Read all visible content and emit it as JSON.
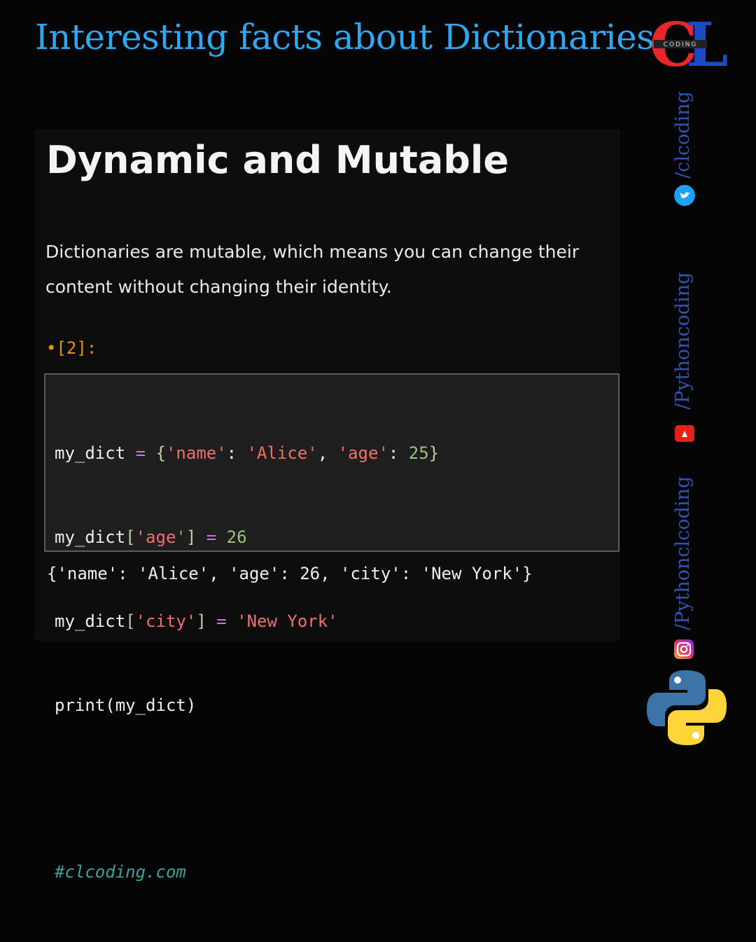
{
  "banner": {
    "title": "Interesting facts about Dictionaries"
  },
  "logo": {
    "letters": "CL",
    "tagline": "CODING"
  },
  "panel": {
    "heading": "Dynamic and Mutable",
    "description": "Dictionaries are mutable, which means you can change their content without changing their identity.",
    "prompt": "•[2]:",
    "code": {
      "line1": {
        "var": "my_dict",
        "op": " = ",
        "open": "{",
        "k1": "'name'",
        "sep1": ": ",
        "v1": "'Alice'",
        "comma": ", ",
        "k2": "'age'",
        "sep2": ": ",
        "v2": "25",
        "close": "}"
      },
      "line2": {
        "var": "my_dict",
        "lb": "[",
        "key": "'age'",
        "rb": "]",
        "op": " = ",
        "val": "26"
      },
      "line3": {
        "var": "my_dict",
        "lb": "[",
        "key": "'city'",
        "rb": "]",
        "op": " = ",
        "val": "'New York'"
      },
      "line4": "print(my_dict)",
      "comment": "#clcoding.com"
    },
    "output": "{'name': 'Alice', 'age': 26, 'city': 'New York'}"
  },
  "social": {
    "twitter_handle": "/clcoding",
    "youtube_handle": "/Pythoncoding",
    "instagram_handle": "/Pythonclcoding"
  },
  "colors": {
    "banner": "#2fa6ee",
    "prompt": "#e8900f",
    "handle": "#2f55b0",
    "logo_red": "#e8262b",
    "logo_blue": "#1c49c4"
  },
  "icons": [
    "twitter-icon",
    "youtube-icon",
    "instagram-icon",
    "python-logo-icon"
  ]
}
